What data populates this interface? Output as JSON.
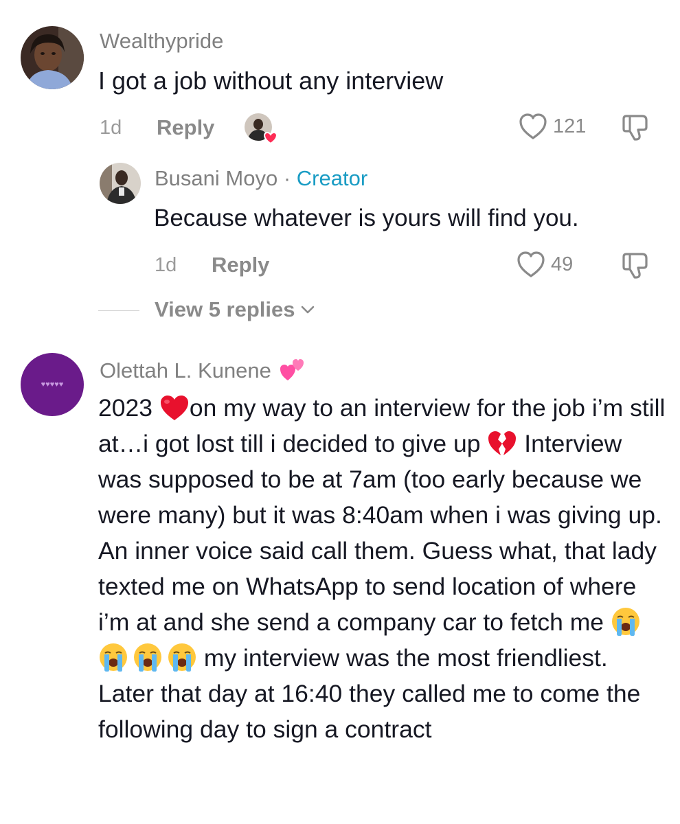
{
  "comments": [
    {
      "username": "Wealthypride",
      "text": "I got a job without any interview",
      "time": "1d",
      "reply_label": "Reply",
      "likes": "121"
    },
    {
      "username": "Olettah L. Kunene",
      "text_parts": [
        "2023 ",
        "on my way to an interview for the job i’m still at…i got lost till i decided to give up ",
        " Interview was supposed to be at 7am (too early because we were many) but it was 8:40am when i was giving up. An inner voice said call them. Guess what, that lady texted me on WhatsApp to send location of where i’m at and she send a company car to fetch me ",
        " my interview was the most friendliest. Later that day at 16:40 they called me to come the following day to sign a contract"
      ],
      "avatar_label": "♥♥♥♥♥",
      "avatar_color": "#6a1b8a"
    }
  ],
  "reply": {
    "username": "Busani Moyo",
    "separator": " · ",
    "creator_label": "Creator",
    "text": "Because whatever is yours will find you.",
    "time": "1d",
    "reply_label": "Reply",
    "likes": "49"
  },
  "view_replies_label": "View 5 replies",
  "colors": {
    "creator": "#1a9cc4",
    "meta": "#8a8a8a",
    "liked_heart": "#fe2c55"
  },
  "icons": [
    "heart-icon",
    "dislike-icon",
    "chevron-down-icon",
    "red-heart-emoji",
    "broken-heart-emoji",
    "crying-face-emoji",
    "two-hearts-emoji"
  ]
}
